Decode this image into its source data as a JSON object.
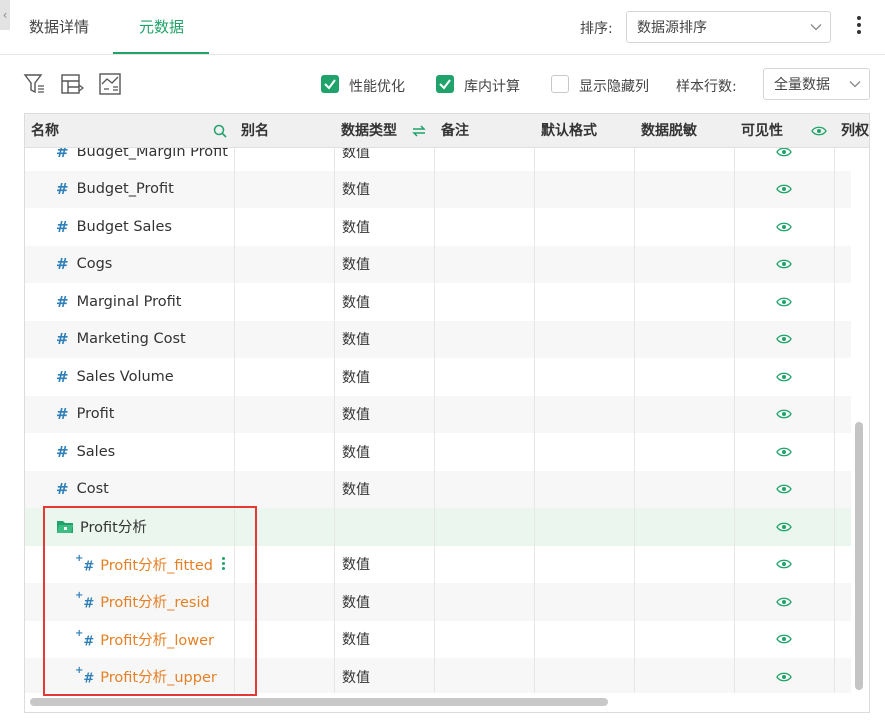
{
  "tabs": [
    {
      "label": "数据详情",
      "active": false
    },
    {
      "label": "元数据",
      "active": true
    }
  ],
  "sort": {
    "label": "排序:",
    "value": "数据源排序"
  },
  "toolbar": {
    "perf_opt_label": "性能优化",
    "perf_opt_checked": true,
    "in_db_calc_label": "库内计算",
    "in_db_calc_checked": true,
    "show_hidden_label": "显示隐藏列",
    "show_hidden_checked": false,
    "sample_rows_label": "样本行数:",
    "sample_rows_value": "全量数据"
  },
  "columns": {
    "name": "名称",
    "alias": "别名",
    "data_type": "数据类型",
    "remark": "备注",
    "default_format": "默认格式",
    "masking": "数据脱敏",
    "visibility": "可见性",
    "column_permission": "列权"
  },
  "rows": [
    {
      "name": "Budget_Margin Profit",
      "type": "数值"
    },
    {
      "name": "Budget_Profit",
      "type": "数值"
    },
    {
      "name": "Budget Sales",
      "type": "数值"
    },
    {
      "name": "Cogs",
      "type": "数值"
    },
    {
      "name": "Marginal Profit",
      "type": "数值"
    },
    {
      "name": "Marketing Cost",
      "type": "数值"
    },
    {
      "name": "Sales Volume",
      "type": "数值"
    },
    {
      "name": "Profit",
      "type": "数值"
    },
    {
      "name": "Sales",
      "type": "数值"
    },
    {
      "name": "Cost",
      "type": "数值"
    }
  ],
  "folder": {
    "name": "Profit分析"
  },
  "calc_rows": [
    {
      "name": "Profit分析_fitted",
      "type": "数值"
    },
    {
      "name": "Profit分析_resid",
      "type": "数值"
    },
    {
      "name": "Profit分析_lower",
      "type": "数值"
    },
    {
      "name": "Profit分析_upper",
      "type": "数值"
    }
  ],
  "colors": {
    "accent": "#20a36a",
    "calc_field": "#e58026",
    "highlight": "#e53935",
    "icon_blue": "#2f7fb8"
  }
}
